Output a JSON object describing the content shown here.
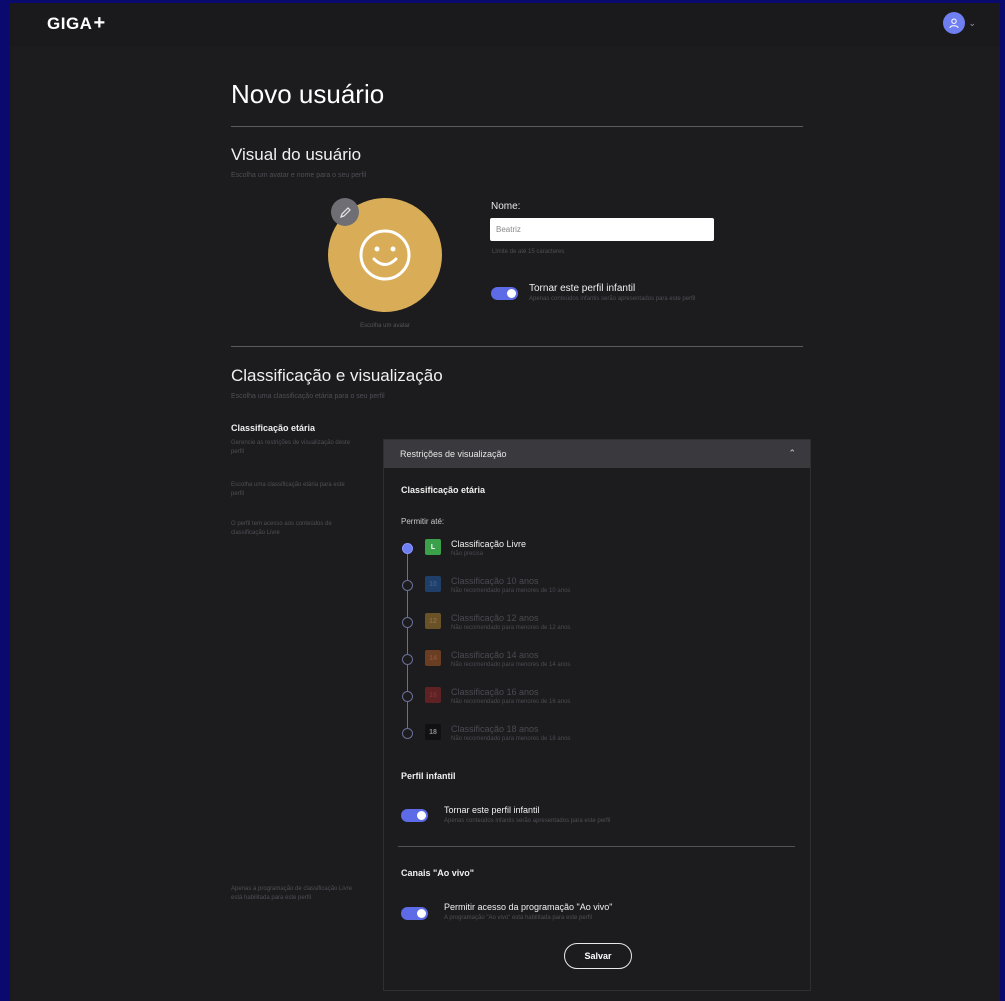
{
  "app": {
    "logo_text": "GIGA",
    "logo_plus": "+"
  },
  "page": {
    "title": "Novo usuário"
  },
  "visual": {
    "title": "Visual do usuário",
    "subtitle": "Escolha um avatar e nome para o seu perfil",
    "avatar_caption": "Escolha um avatar",
    "name_label": "Nome:",
    "name_value": "Beatriz",
    "name_hint": "Limite de até 15 caracteres",
    "kid_toggle_label": "Tornar este perfil infantil",
    "kid_toggle_desc": "Apenas conteúdos infantis serão apresentados para este perfil",
    "kid_toggle_on": true
  },
  "classification": {
    "title": "Classificação e visualização",
    "subtitle": "Escolha uma classificação etária para o seu perfil",
    "left_title": "Classificação etária",
    "left_notes": [
      "Gerencie as restrições de visualização deste perfil",
      "Escolha uma classificação etária para este perfil",
      "O perfil tem acesso aos conteúdos de classificação Livre"
    ],
    "live_note": "Apenas a programação de classificação Livre está habilitada para este perfil"
  },
  "panel": {
    "header": "Restrições de visualização",
    "section_rating": "Classificação etária",
    "permit_label": "Permitir até:",
    "ratings": [
      {
        "badge": "L",
        "label": "Classificação Livre",
        "sub": "Não precisa",
        "color": "#3aa14a",
        "active": true
      },
      {
        "badge": "10",
        "label": "Classificação 10 anos",
        "sub": "Não recomendado para menores de 10 anos",
        "color": "#2a5a9a",
        "active": false
      },
      {
        "badge": "12",
        "label": "Classificação 12 anos",
        "sub": "Não recomendado para menores de 12 anos",
        "color": "#b98a2a",
        "active": false
      },
      {
        "badge": "14",
        "label": "Classificação 14 anos",
        "sub": "Não recomendado para menores de 14 anos",
        "color": "#b8642a",
        "active": false
      },
      {
        "badge": "16",
        "label": "Classificação 16 anos",
        "sub": "Não recomendado para menores de 16 anos",
        "color": "#a8302a",
        "active": false
      },
      {
        "badge": "18",
        "label": "Classificação 18 anos",
        "sub": "Não recomendado para menores de 18 anos",
        "color": "#111113",
        "active": false
      }
    ],
    "section_kid": "Perfil infantil",
    "kid_label": "Tornar este perfil infantil",
    "kid_desc": "Apenas conteúdos infantis serão apresentados para este perfil",
    "section_live": "Canais \"Ao vivo\"",
    "live_label": "Permitir acesso da programação \"Ao vivo\"",
    "live_desc": "A programação \"Ao vivo\" está habilitada para este perfil",
    "save": "Salvar"
  }
}
